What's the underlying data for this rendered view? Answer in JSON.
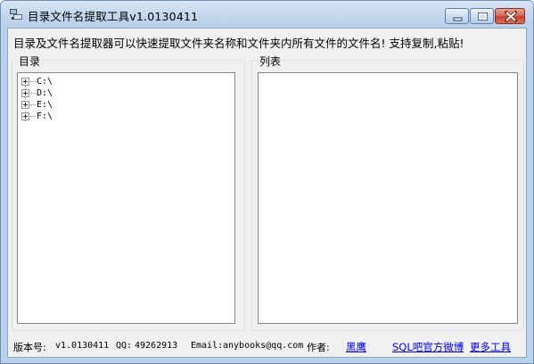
{
  "window": {
    "title": "目录文件名提取工具v1.0130411"
  },
  "description": "目录及文件名提取器可以快速提取文件夹名称和文件夹内所有文件的文件名! 支持复制,粘贴!",
  "groups": {
    "directory_label": "目录",
    "list_label": "列表"
  },
  "tree": {
    "items": [
      {
        "label": "C:\\"
      },
      {
        "label": "D:\\"
      },
      {
        "label": "E:\\"
      },
      {
        "label": "F:\\"
      }
    ]
  },
  "footer": {
    "version_label": "版本号:",
    "version_value": "v1.0130411",
    "qq_label": "QQ:",
    "qq_value": "49262913",
    "email_label": "Email:",
    "email_value": "anybooks@qq.com",
    "author_label": "作者:",
    "author_link": "黑鹰",
    "weibo_link": "SQL吧官方微博",
    "more_link": "更多工具"
  },
  "colors": {
    "titlebar": "#c4d8ee",
    "client_bg": "#f0f0f0",
    "link": "#0000ee",
    "close_button": "#c3412e"
  }
}
